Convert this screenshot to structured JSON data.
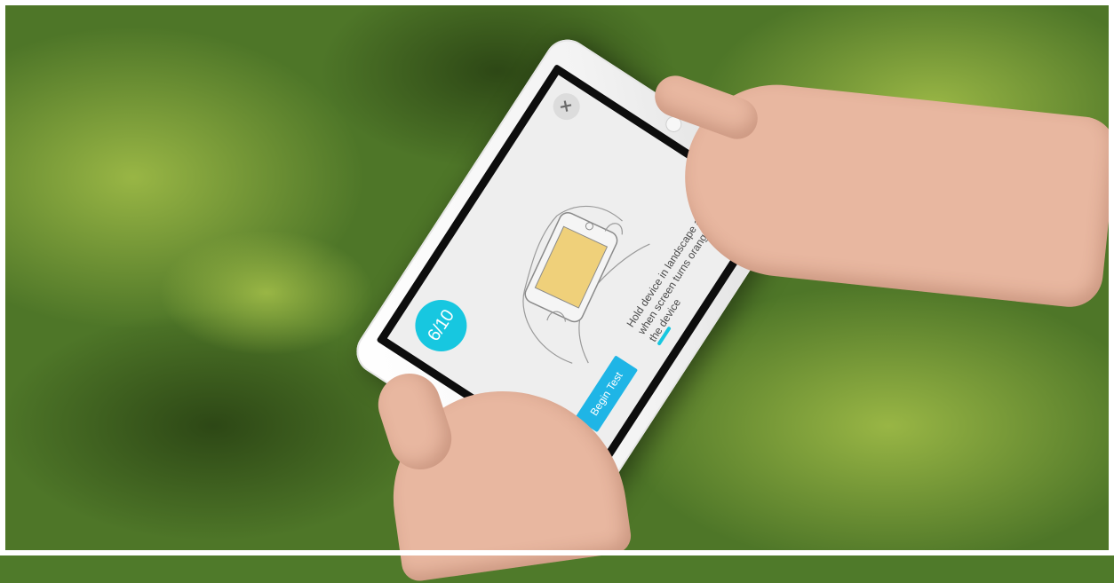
{
  "screen": {
    "progress": "6/10",
    "begin_button": "Begin Test",
    "instruction": "Hold device in landscape and when screen turns orange, shake the device",
    "close_icon": "close-icon"
  },
  "colors": {
    "accent": "#17c7e0",
    "button": "#1fb5e6",
    "phone_screen": "#efd07a"
  }
}
